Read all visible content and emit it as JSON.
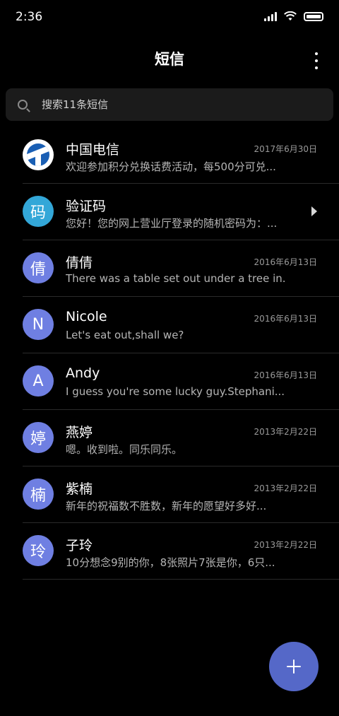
{
  "status_bar": {
    "time": "2:36"
  },
  "header": {
    "title": "短信"
  },
  "search": {
    "placeholder": "搜索11条短信"
  },
  "messages": [
    {
      "name": "中国电信",
      "preview": "欢迎参加积分兑换话费活动，每500分可兑...",
      "date": "2017年6月30日",
      "avatar_text": "",
      "avatar_color": "#ffffff",
      "icon": "china-telecom-logo"
    },
    {
      "name": "验证码",
      "preview": "您好！您的网上营业厅登录的随机密码为：...",
      "date": "",
      "avatar_text": "码",
      "avatar_color": "#33a7d8",
      "icon": "chevron-right-icon"
    },
    {
      "name": "倩倩",
      "preview": "There was a table set out under a tree in...",
      "date": "2016年6月13日",
      "avatar_text": "倩",
      "avatar_color": "#6f7fe2"
    },
    {
      "name": "Nicole",
      "preview": "Let's eat out,shall we?",
      "date": "2016年6月13日",
      "avatar_text": "N",
      "avatar_color": "#6f7fe2"
    },
    {
      "name": "Andy",
      "preview": "I guess you're some lucky guy.Stephani...",
      "date": "2016年6月13日",
      "avatar_text": "A",
      "avatar_color": "#6f7fe2"
    },
    {
      "name": "燕婷",
      "preview": "嗯。收到啦。同乐同乐。",
      "date": "2013年2月22日",
      "avatar_text": "婷",
      "avatar_color": "#6f7fe2"
    },
    {
      "name": "紫楠",
      "preview": "新年的祝福数不胜数，新年的愿望好多好...",
      "date": "2013年2月22日",
      "avatar_text": "楠",
      "avatar_color": "#6f7fe2"
    },
    {
      "name": "子玲",
      "preview": "10分想念9别的你，8张照片7张是你，6只...",
      "date": "2013年2月22日",
      "avatar_text": "玲",
      "avatar_color": "#6f7fe2"
    }
  ],
  "fab": {
    "icon": "plus-icon"
  }
}
